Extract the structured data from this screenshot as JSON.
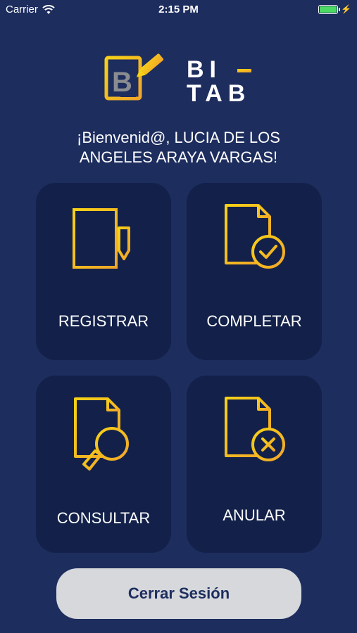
{
  "status_bar": {
    "carrier": "Carrier",
    "time": "2:15 PM",
    "battery_level": 1.0,
    "icons": [
      "wifi-icon",
      "battery-icon",
      "charging-bolt-icon"
    ]
  },
  "logo": {
    "text_line1": "BI",
    "text_line2": "TAB",
    "icon": "b-pencil-logo-icon"
  },
  "greeting": {
    "line1": "¡Bienvenid@, LUCIA DE LOS",
    "line2": "ANGELES ARAYA VARGAS!"
  },
  "tiles": [
    {
      "label": "REGISTRAR",
      "icon": "document-pencil-icon"
    },
    {
      "label": "COMPLETAR",
      "icon": "document-check-icon"
    },
    {
      "label": "CONSULTAR",
      "icon": "document-search-icon"
    },
    {
      "label": "ANULAR",
      "icon": "document-cancel-icon"
    }
  ],
  "logout_button": {
    "label": "Cerrar Sesión"
  },
  "colors": {
    "background": "#1d2d5e",
    "tile": "#13214a",
    "accent_yellow": "#f5c518",
    "accent_orange": "#f0a52a",
    "button": "#d6d8dc"
  }
}
